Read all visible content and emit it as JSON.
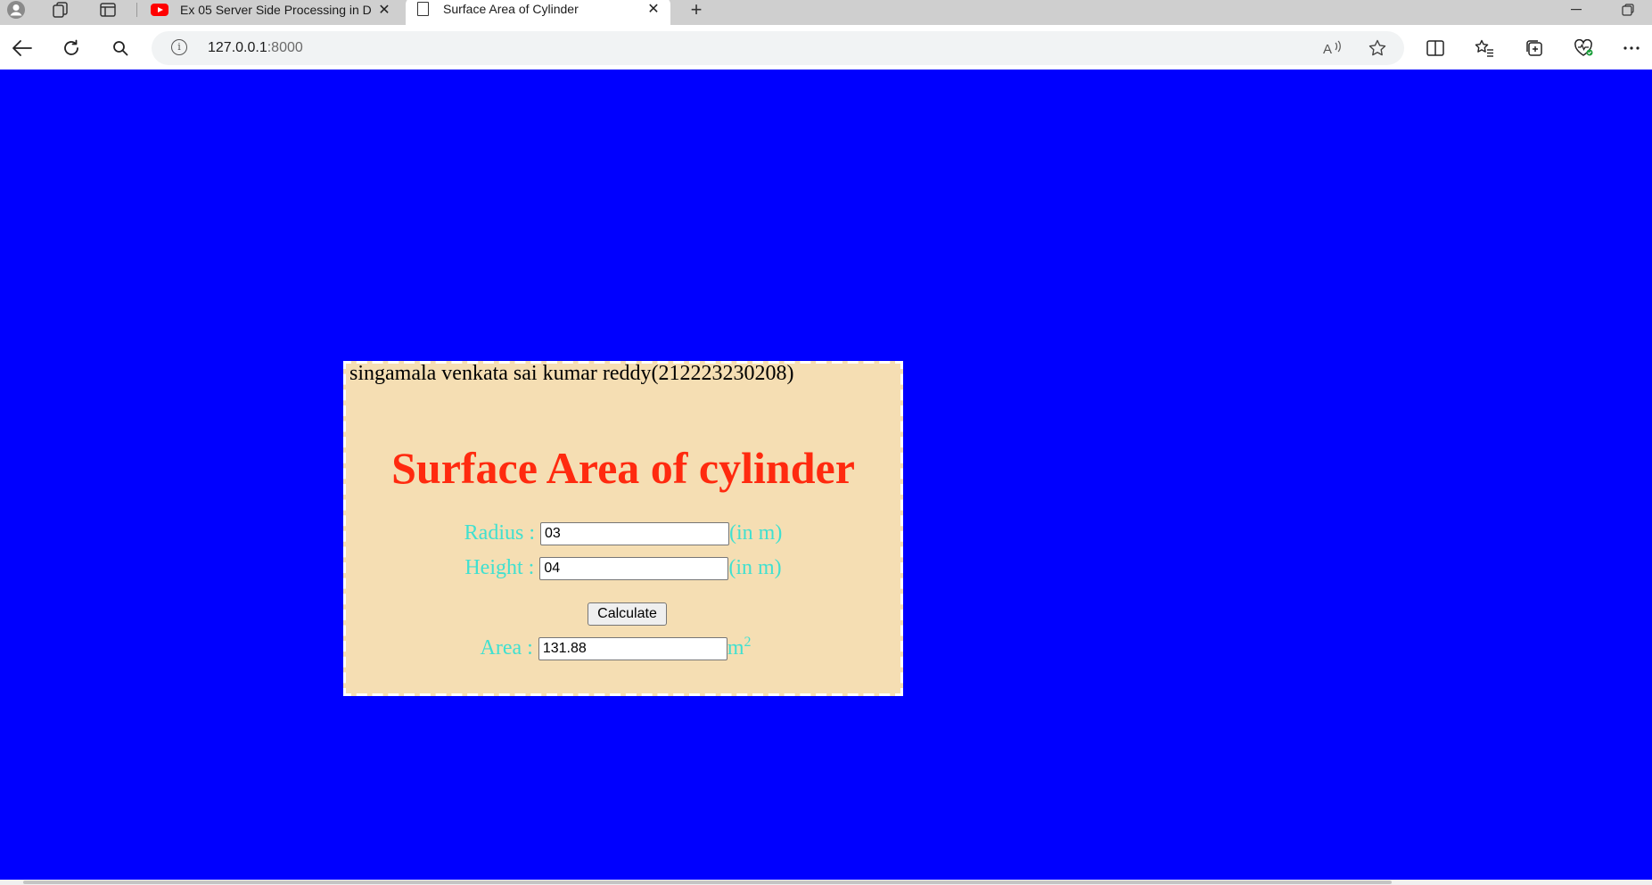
{
  "browser": {
    "tabs": [
      {
        "title": "Ex 05 Server Side Processing in D",
        "favicon": "youtube-icon",
        "active": false
      },
      {
        "title": "Surface Area of Cylinder",
        "favicon": "document-icon",
        "active": true
      }
    ],
    "address": {
      "host": "127.0.0.1",
      "port": ":8000"
    }
  },
  "page": {
    "background_color": "#0000ff",
    "author_line": "singamala venkata sai kumar reddy(212223230208)",
    "heading": "Surface Area of cylinder",
    "heading_color": "#ff2a0f",
    "label_color": "#40e0d0",
    "container_color": "#f5deb3",
    "radius": {
      "label": "Radius :",
      "value": "03",
      "unit": "(in m)"
    },
    "height": {
      "label": "Height :",
      "value": "04",
      "unit": "(in m)"
    },
    "calculate_label": "Calculate",
    "area": {
      "label": "Area :",
      "value": "131.88",
      "unit_base": "m",
      "unit_exp": "2"
    }
  }
}
